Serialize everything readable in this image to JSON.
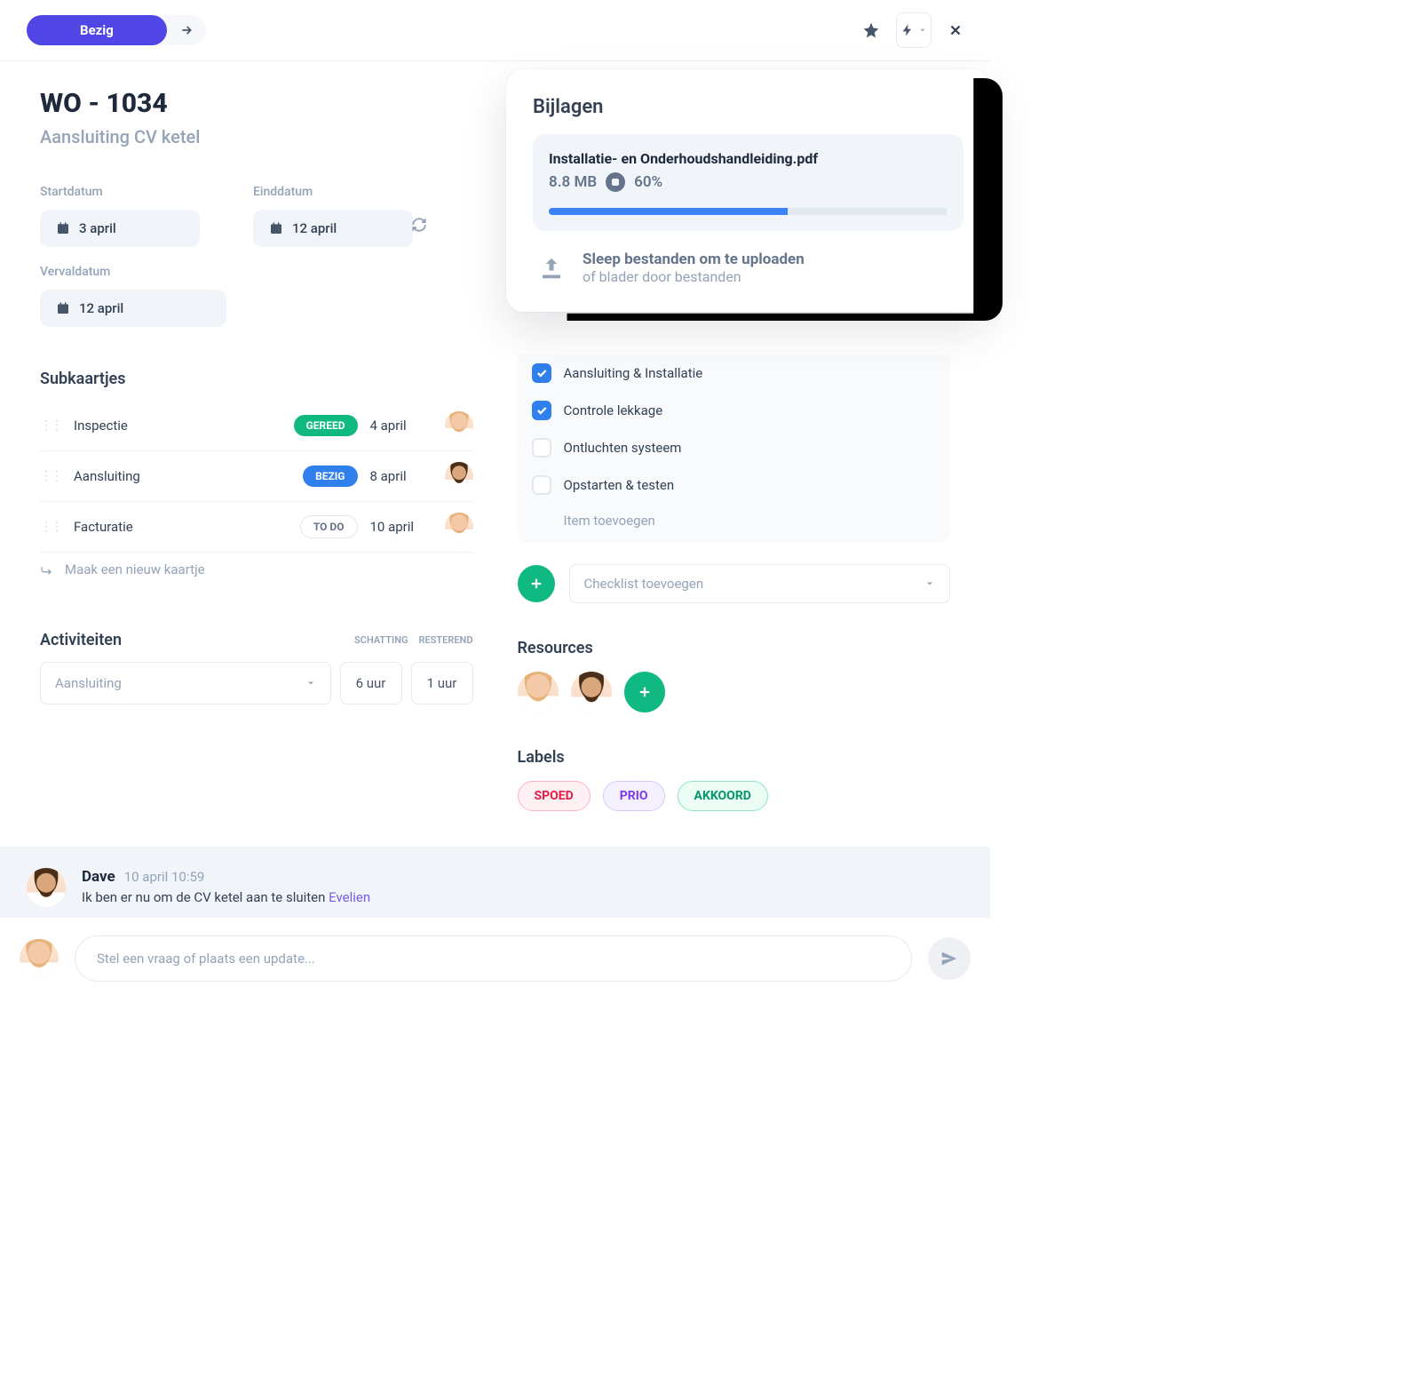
{
  "header": {
    "status_label": "Bezig"
  },
  "work_order": {
    "title": "WO - 1034",
    "subtitle": "Aansluiting CV ketel"
  },
  "dates": {
    "start_label": "Startdatum",
    "start_value": "3 april",
    "end_label": "Einddatum",
    "end_value": "12 april",
    "due_label": "Vervaldatum",
    "due_value": "12 april"
  },
  "subcards": {
    "title": "Subkaartjes",
    "items": [
      {
        "name": "Inspectie",
        "status": "GEREED",
        "date": "4 april",
        "assignee": "female"
      },
      {
        "name": "Aansluiting",
        "status": "BEZIG",
        "date": "8 april",
        "assignee": "male"
      },
      {
        "name": "Facturatie",
        "status": "TO DO",
        "date": "10 april",
        "assignee": "female"
      }
    ],
    "new_card": "Maak een nieuw kaartje"
  },
  "activities": {
    "title": "Activiteiten",
    "col_estimate": "SCHATTING",
    "col_remaining": "RESTEREND",
    "select_placeholder": "Aansluiting",
    "estimate": "6 uur",
    "remaining": "1 uur"
  },
  "checklist": {
    "items": [
      {
        "label": "Aansluiting & Installatie",
        "checked": true
      },
      {
        "label": "Controle lekkage",
        "checked": true
      },
      {
        "label": "Ontluchten systeem",
        "checked": false
      },
      {
        "label": "Opstarten & testen",
        "checked": false
      }
    ],
    "add_item": "Item toevoegen",
    "add_checklist": "Checklist toevoegen"
  },
  "resources": {
    "title": "Resources"
  },
  "labels": {
    "title": "Labels",
    "items": [
      "SPOED",
      "PRIO",
      "AKKOORD"
    ]
  },
  "attachments": {
    "title": "Bijlagen",
    "file_name": "Installatie- en Onderhoudshandleiding.pdf",
    "file_size": "8.8 MB",
    "progress_pct": "60%",
    "progress_value": 60,
    "drop_title": "Sleep bestanden om te uploaden",
    "drop_sub": "of blader door bestanden"
  },
  "comments": {
    "author": "Dave",
    "timestamp": "10 april 10:59",
    "body_text": "Ik ben er nu om de CV ketel aan te sluiten ",
    "mention": "Evelien",
    "compose_placeholder": "Stel een vraag of plaats een update..."
  }
}
